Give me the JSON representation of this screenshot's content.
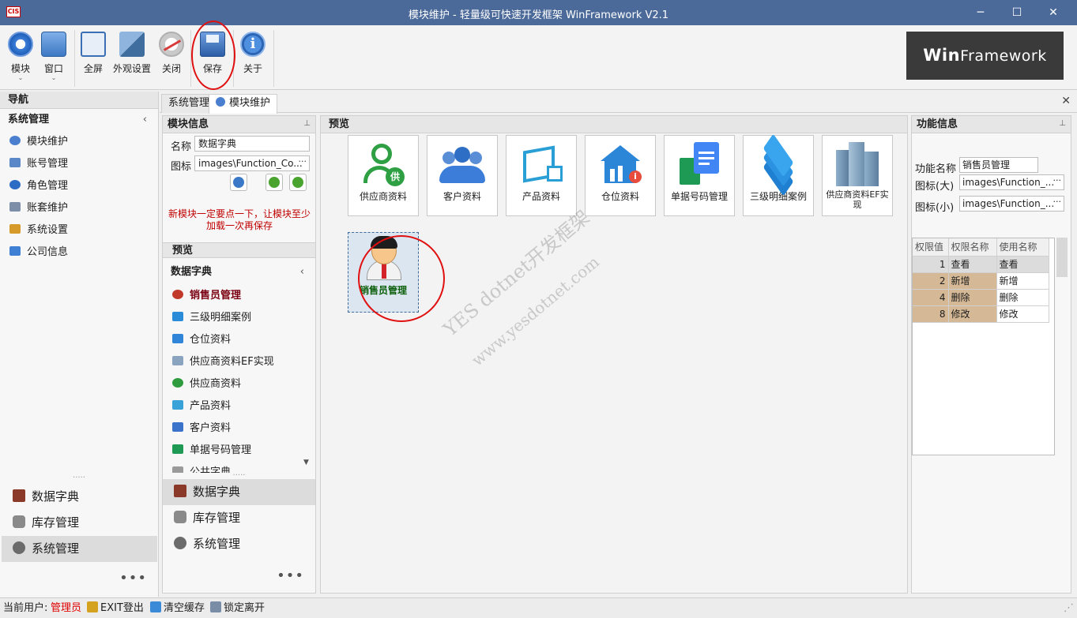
{
  "window": {
    "logo_text": "CIS",
    "title": "模块维护 - 轻量级可快速开发框架 WinFramework V2.1",
    "min": "─",
    "max": "☐",
    "close": "✕"
  },
  "ribbon": {
    "buttons": [
      {
        "label": "模块",
        "icon": "compass-icon",
        "has_dropdown": true
      },
      {
        "label": "窗口",
        "icon": "window-icon",
        "has_dropdown": true
      },
      {
        "label": "全屏",
        "icon": "fullscreen-icon"
      },
      {
        "label": "外观设置",
        "icon": "appearance-icon"
      },
      {
        "label": "关闭",
        "icon": "close-eye-icon"
      },
      {
        "label": "保存",
        "icon": "save-icon"
      },
      {
        "label": "关于",
        "icon": "info-icon"
      }
    ],
    "dropdown_arrow": "⌄",
    "brand_win": "Win",
    "brand_fw": "Framework"
  },
  "nav": {
    "title": "导航",
    "group": "系统管理",
    "group_chevron": "‹",
    "items": [
      "模块维护",
      "账号管理",
      "角色管理",
      "账套维护",
      "系统设置",
      "公司信息"
    ],
    "dots": "·····",
    "bottom": [
      "数据字典",
      "库存管理",
      "系统管理"
    ],
    "more": "•••"
  },
  "tabs": {
    "items": [
      "系统管理",
      "模块维护"
    ],
    "close": "✕"
  },
  "module_info": {
    "title": "模块信息",
    "pin": "📌",
    "name_label": "名称",
    "name_value": "数据字典",
    "icon_label": "图标",
    "icon_value": "images\\Function_Co...",
    "ellipsis": "···",
    "warning": "新模块一定要点一下，让模块至少加载一次再保存",
    "preview_title": "预览",
    "dict_title": "数据字典",
    "dict_chevron": "‹",
    "list": [
      "销售员管理",
      "三级明细案例",
      "仓位资料",
      "供应商资料EF实现",
      "供应商资料",
      "产品资料",
      "客户资料",
      "单据号码管理",
      "公共字典"
    ],
    "scroll_down": "▼",
    "dots": "·····",
    "bottom": [
      "数据字典",
      "库存管理",
      "系统管理"
    ],
    "more": "•••"
  },
  "preview": {
    "title": "预览",
    "tiles": [
      "供应商资料",
      "客户资料",
      "产品资料",
      "仓位资料",
      "单据号码管理",
      "三级明细案例",
      "供应商资料EF实现"
    ],
    "selected_tile": "销售员管理",
    "watermark1": "YES dotnet开发框架",
    "watermark2": "www.yesdotnet.com"
  },
  "func_info": {
    "title": "功能信息",
    "pin": "📌",
    "name_label": "功能名称",
    "name_value": "销售员管理",
    "large_icon_label": "图标(大)",
    "large_icon_value": "images\\Function_...",
    "small_icon_label": "图标(小)",
    "small_icon_value": "images\\Function_...",
    "ellipsis": "···",
    "columns": [
      "权限值",
      "权限名称",
      "使用名称"
    ],
    "rows": [
      {
        "value": "1",
        "name": "查看",
        "use": "查看"
      },
      {
        "value": "2",
        "name": "新增",
        "use": "新增"
      },
      {
        "value": "4",
        "name": "删除",
        "use": "删除"
      },
      {
        "value": "8",
        "name": "修改",
        "use": "修改"
      }
    ]
  },
  "status": {
    "user_label": "当前用户:",
    "user_value": "管理员",
    "exit": "EXIT登出",
    "clear_cache": "清空缓存",
    "lock": "锁定离开",
    "colors": {
      "user": "#e00000"
    }
  }
}
